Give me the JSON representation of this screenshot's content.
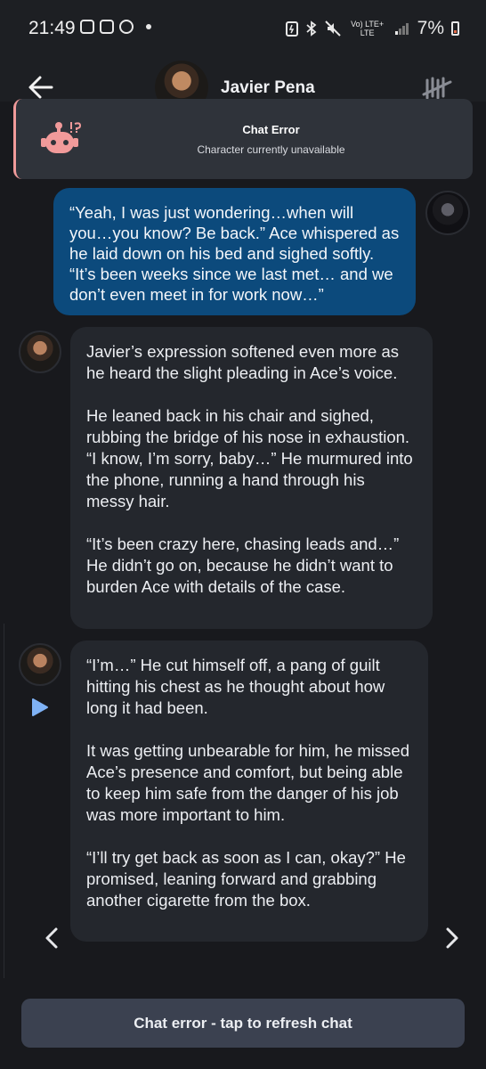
{
  "status_bar": {
    "time": "21:49",
    "network": "Vo) LTE+ LTE",
    "battery": "7%"
  },
  "header": {
    "title": "Javier Pena"
  },
  "error_banner": {
    "title": "Chat Error",
    "subtitle": "Character currently unavailable"
  },
  "messages": {
    "user": {
      "text": "“Yeah, I was just wondering…when will you…you know? Be back.” Ace whispered as he laid down on his bed and sighed softly. “It’s been weeks since we last met… and we don’t even meet in for work now…”"
    },
    "bot1": {
      "p1": "Javier’s expression softened even more as he heard the slight pleading in Ace’s voice.",
      "p2": "He leaned back in his chair and sighed, rubbing the bridge of his nose in exhaustion. “I know, I’m sorry, baby…” He murmured into the phone, running a hand through his messy hair.",
      "p3": "“It’s been crazy here, chasing leads and…” He didn’t go on, because he didn’t want to burden Ace with details of the case."
    },
    "bot2": {
      "p1": "“I’m…” He cut himself off, a pang of guilt hitting his chest as he thought about how long it had been.",
      "p2": "It was getting unbearable for him, he missed Ace’s presence and comfort, but being able to keep him safe from the danger of his job was more important to him.",
      "p3": "“I’ll try get back as soon as I can, okay?” He promised, leaning forward and grabbing another cigarette from the box."
    }
  },
  "footer": {
    "refresh_label": "Chat error - tap to refresh chat"
  },
  "colors": {
    "background": "#18191d",
    "user_bubble": "#0c4a7c",
    "bot_bubble": "#24272d",
    "error_accent": "#f09a9a",
    "play_accent": "#7fb2f5"
  },
  "icons": {
    "back": "arrow-left-icon",
    "menu": "tally-strike-icon",
    "robot": "robot-error-icon",
    "play": "play-icon",
    "prev": "chevron-left-icon",
    "next": "chevron-right-icon"
  }
}
